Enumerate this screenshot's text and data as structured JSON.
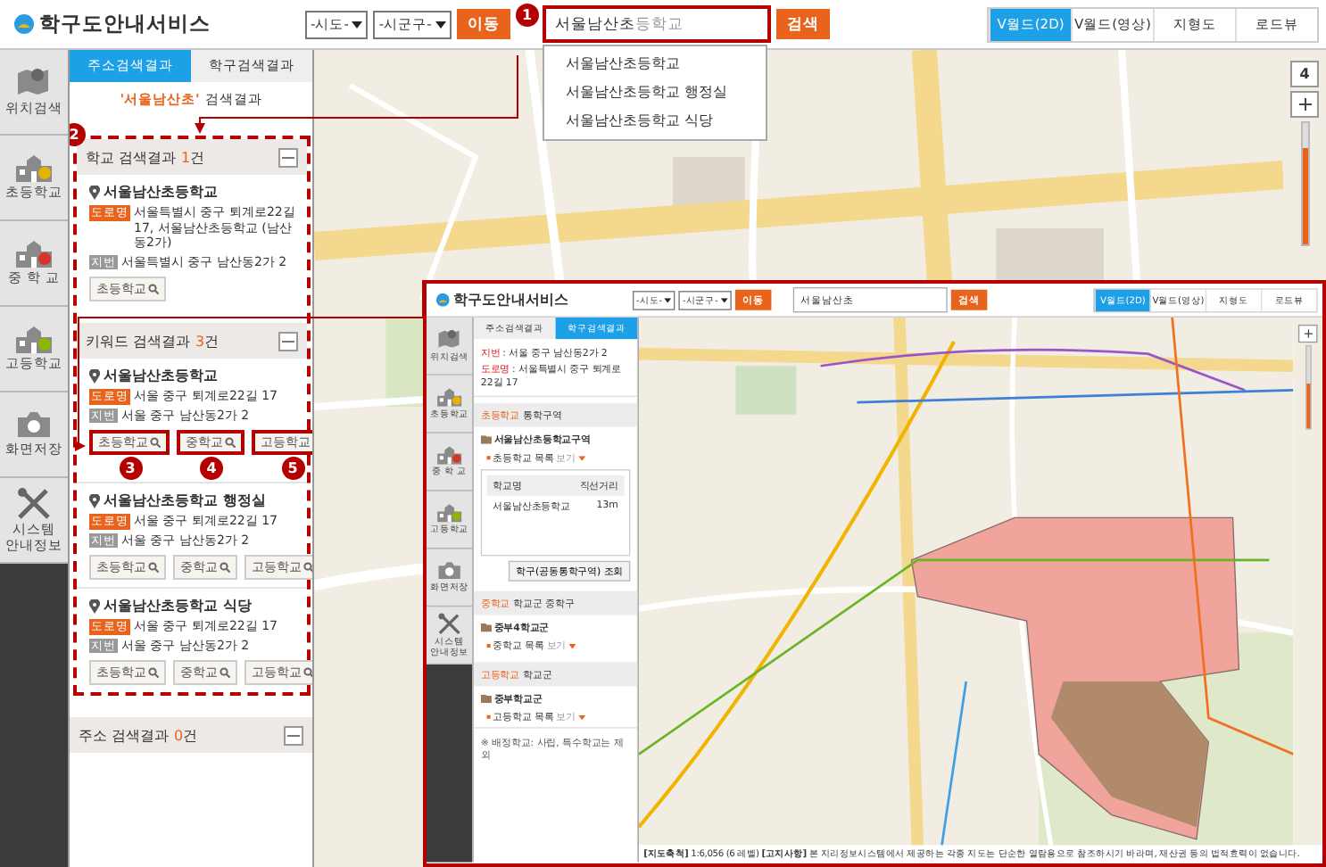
{
  "app": {
    "title": "학구도안내서비스"
  },
  "toolbar": {
    "sido": "-시도-",
    "sigungu": "-시군구-",
    "move_button": "이동",
    "search": {
      "typed": "서울남산초",
      "completion": "등학교",
      "highlighted": true,
      "callout": "1"
    },
    "search_button": "검색",
    "map_types": [
      {
        "label": "V월드(2D)",
        "selected": true
      },
      {
        "label": "V월드(영상)",
        "selected": false
      },
      {
        "label": "지형도",
        "selected": false
      },
      {
        "label": "로드뷰",
        "selected": false
      }
    ]
  },
  "suggestions": [
    "서울남산초등학교",
    "서울남산초등학교 행정실",
    "서울남산초등학교 식당"
  ],
  "sidebar": [
    {
      "label": "위치검색"
    },
    {
      "label": "초등학교"
    },
    {
      "label": "중 학 교"
    },
    {
      "label": "고등학교"
    },
    {
      "label": "화면저장"
    },
    {
      "label": "시스템 안내정보"
    }
  ],
  "results_panel": {
    "tabs": [
      {
        "label": "주소검색결과",
        "selected": true
      },
      {
        "label": "학구검색결과",
        "selected": false
      }
    ],
    "query": {
      "keyword": "'서울남산초'",
      "suffix": "검색결과"
    },
    "frame_callout": "2",
    "framed_sections": [
      {
        "title": "학교 검색결과",
        "count": "1",
        "unit": "건",
        "items": [
          {
            "name": "서울남산초등학교",
            "road_badge": "도로명",
            "road": "서울특별시 중구 퇴계로22길 17, 서울남산초등학교 (남산동2가)",
            "jibun_badge": "지번",
            "jibun": "서울특별시 중구 남산동2가 2",
            "buttons": [
              {
                "label": "초등학교",
                "highlighted": false
              }
            ]
          }
        ]
      },
      {
        "title": "키워드 검색결과",
        "count": "3",
        "unit": "건",
        "items": [
          {
            "name": "서울남산초등학교",
            "road_badge": "도로명",
            "road": "서울 중구 퇴계로22길 17",
            "jibun_badge": "지번",
            "jibun": "서울 중구 남산동2가 2",
            "buttons": [
              {
                "label": "초등학교",
                "highlighted": true,
                "callout": "3"
              },
              {
                "label": "중학교",
                "highlighted": true,
                "callout": "4"
              },
              {
                "label": "고등학교",
                "highlighted": true,
                "callout": "5"
              }
            ]
          },
          {
            "name": "서울남산초등학교 행정실",
            "road_badge": "도로명",
            "road": "서울 중구 퇴계로22길 17",
            "jibun_badge": "지번",
            "jibun": "서울 중구 남산동2가 2",
            "buttons": [
              {
                "label": "초등학교",
                "highlighted": false
              },
              {
                "label": "중학교",
                "highlighted": false
              },
              {
                "label": "고등학교",
                "highlighted": false
              }
            ]
          },
          {
            "name": "서울남산초등학교 식당",
            "road_badge": "도로명",
            "road": "서울 중구 퇴계로22길 17",
            "jibun_badge": "지번",
            "jibun": "서울 중구 남산동2가 2",
            "buttons": [
              {
                "label": "초등학교",
                "highlighted": false
              },
              {
                "label": "중학교",
                "highlighted": false
              },
              {
                "label": "고등학교",
                "highlighted": false
              }
            ]
          }
        ]
      }
    ],
    "other_sections": [
      {
        "title": "주소 검색결과",
        "count": "0",
        "unit": "건"
      }
    ]
  },
  "zoom": {
    "level_label": "4",
    "level": 0.8
  },
  "inset": {
    "app": {
      "title": "학구도안내서비스"
    },
    "toolbar": {
      "sido": "-시도-",
      "sigungu": "-시군구-",
      "move_button": "이동",
      "search": {
        "typed": "서울남산초",
        "highlighted": false
      },
      "search_button": "검색",
      "map_types": [
        {
          "label": "V월드(2D)",
          "selected": true
        },
        {
          "label": "V월드(영상)",
          "selected": false
        },
        {
          "label": "지형도",
          "selected": false
        },
        {
          "label": "로드뷰",
          "selected": false
        }
      ]
    },
    "sidebar": [
      {
        "label": "위치검색"
      },
      {
        "label": "초등학교"
      },
      {
        "label": "중 학 교"
      },
      {
        "label": "고등학교"
      },
      {
        "label": "화면저장"
      },
      {
        "label": "시스템 안내정보"
      }
    ],
    "tabs": [
      {
        "label": "주소검색결과",
        "selected": false
      },
      {
        "label": "학구검색결과",
        "selected": true
      }
    ],
    "address": [
      {
        "label": "지번",
        "text": ": 서울 중구 남산동2가 2"
      },
      {
        "label": "도로명",
        "text": ": 서울특별시 중구 퇴계로22길 17"
      }
    ],
    "zones": [
      {
        "tag": "초등학교",
        "title": "통학구역",
        "name": "서울남산초등학교구역",
        "toggle": {
          "label": "초등학교 목록",
          "action": "보기"
        },
        "table": {
          "columns": [
            "학교명",
            "직선거리"
          ],
          "rows": [
            [
              "서울남산초등학교",
              "13m"
            ]
          ]
        },
        "button": "학구(공동통학구역) 조회"
      },
      {
        "tag": "중학교",
        "title": "학교군 중학구",
        "name": "중부4학교군",
        "toggle": {
          "label": "중학교 목록",
          "action": "보기"
        }
      },
      {
        "tag": "고등학교",
        "title": "학교군",
        "name": "중부학교군",
        "toggle": {
          "label": "고등학교 목록",
          "action": "보기"
        }
      }
    ],
    "note": "※ 배정학교: 사립, 특수학교는 제외",
    "footer": "**[지도축척]** 1:6,056 (6 레벨) **[고지사항]** 본 지리정보시스템에서 제공하는 각종 지도는 단순한 열람용으로 참조하시기 바라며, 재산권 등의 법적효력이 없습니다.",
    "zoom": {
      "level": 0.55
    }
  }
}
